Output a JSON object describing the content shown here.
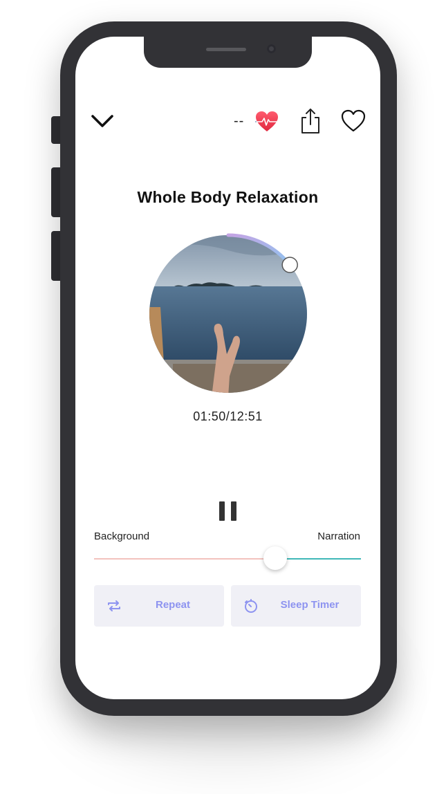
{
  "header": {
    "heart_rate_text": "--"
  },
  "track": {
    "title": "Whole Body Relaxation",
    "time_display": "01:50/12:51",
    "progress_fraction": 0.143
  },
  "mix": {
    "left_label": "Background",
    "right_label": "Narration",
    "balance_fraction": 0.68
  },
  "actions": {
    "repeat_label": "Repeat",
    "sleep_timer_label": "Sleep Timer"
  },
  "colors": {
    "accent": "#8d93f0",
    "progress_start": "#c4a4e4",
    "progress_end": "#8fc3ef",
    "slider_left": "#f3c2bd",
    "slider_right": "#3fb8b8"
  },
  "icons": [
    "chevron-down-icon",
    "heart-rate-icon",
    "share-icon",
    "heart-outline-icon",
    "pause-icon",
    "repeat-icon",
    "sleep-timer-icon"
  ]
}
